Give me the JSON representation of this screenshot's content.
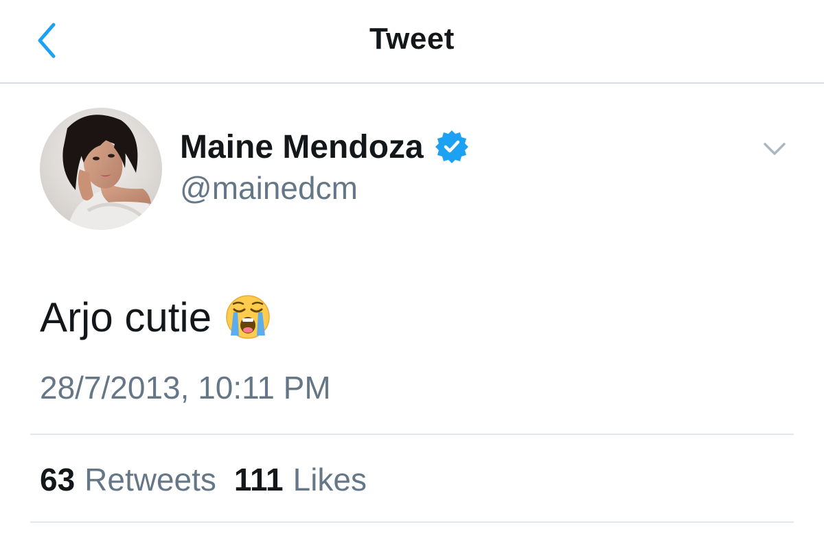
{
  "header": {
    "title": "Tweet",
    "back_icon": "chevron-left-icon",
    "accent_color": "#1da1f2"
  },
  "tweet": {
    "author": {
      "display_name": "Maine Mendoza",
      "handle": "@mainedcm",
      "verified": true,
      "avatar": "profile-photo"
    },
    "text": "Arjo cutie",
    "emoji": "loudly-crying-face",
    "timestamp": "28/7/2013, 10:11 PM",
    "stats": {
      "retweets_count": "63",
      "retweets_label": "Retweets",
      "likes_count": "111",
      "likes_label": "Likes"
    }
  },
  "colors": {
    "text_primary": "#14171a",
    "text_secondary": "#657786",
    "divider": "#e1e8ed",
    "verified_blue": "#1da1f2"
  }
}
